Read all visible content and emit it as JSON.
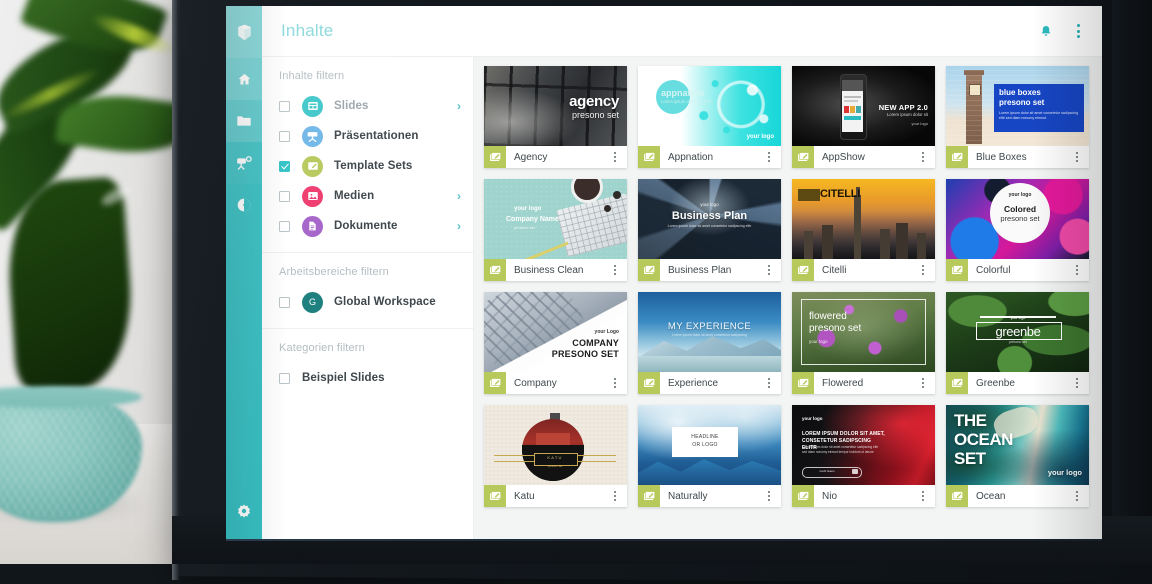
{
  "app": {
    "rail": {
      "logo_icon": "presono-logo-icon",
      "items": [
        {
          "name": "home",
          "icon": "home-icon"
        },
        {
          "name": "folder",
          "icon": "folder-icon"
        },
        {
          "name": "presentations",
          "icon": "projector-icon"
        },
        {
          "name": "analytics",
          "icon": "pie-chart-icon"
        }
      ],
      "settings_icon": "gear-icon"
    },
    "header": {
      "title": "Inhalte",
      "bell_icon": "bell-icon",
      "menu_icon": "kebab-menu-icon"
    },
    "filters": {
      "sections": [
        {
          "title": "Inhalte filtern",
          "rows": [
            {
              "label": "Slides",
              "checked": false,
              "chevron": true,
              "icon": "slides-icon",
              "color": "#3fc6c9"
            },
            {
              "label": "Präsentationen",
              "checked": false,
              "chevron": false,
              "icon": "projector-icon",
              "color": "#6fb6e8"
            },
            {
              "label": "Template Sets",
              "checked": true,
              "chevron": false,
              "icon": "template-edit-icon",
              "color": "#b6c95a"
            },
            {
              "label": "Medien",
              "checked": false,
              "chevron": true,
              "icon": "media-image-icon",
              "color": "#ef3a6e"
            },
            {
              "label": "Dokumente",
              "checked": false,
              "chevron": true,
              "icon": "document-icon",
              "color": "#a563c9"
            }
          ]
        },
        {
          "title": "Arbeitsbereiche filtern",
          "rows": [
            {
              "label": "Global Workspace",
              "checked": false,
              "chevron": false,
              "icon": "workspace-badge",
              "badge": "G",
              "color": "#1b7f7d"
            }
          ]
        },
        {
          "title": "Kategorien filtern",
          "rows": [
            {
              "label": "Beispiel Slides",
              "checked": false,
              "chevron": false,
              "icon": "none"
            }
          ]
        }
      ]
    },
    "content": {
      "card_icon": "template-edit-icon",
      "card_menu_icon": "kebab-menu-icon",
      "cards": [
        {
          "label": "Agency",
          "art": "agency",
          "title": "agency",
          "subtitle": "presono set"
        },
        {
          "label": "Appnation",
          "art": "appnation",
          "title": "appnation",
          "subtitle": "Lorem ipsum dolor sit amet",
          "logo": "your logo"
        },
        {
          "label": "AppShow",
          "art": "appshow",
          "title": "NEW APP 2.0",
          "subtitle": "Lorem ipsum dolor sit",
          "logo": "your logo"
        },
        {
          "label": "Blue Boxes",
          "art": "blueboxes",
          "title": "blue boxes",
          "subtitle": "presono set"
        },
        {
          "label": "Business Clean",
          "art": "bizclean",
          "title": "Company Name",
          "logo": "your logo"
        },
        {
          "label": "Business Plan",
          "art": "bizplan",
          "title": "Business Plan",
          "logo": "your logo"
        },
        {
          "label": "Citelli",
          "art": "citelli",
          "title": "CITELLI"
        },
        {
          "label": "Colorful",
          "art": "colorful",
          "title": "Colored",
          "subtitle": "presono set",
          "logo": "your logo"
        },
        {
          "label": "Company",
          "art": "company",
          "title": "COMPANY",
          "subtitle": "PRESONO SET",
          "logo": "your Logo"
        },
        {
          "label": "Experience",
          "art": "experience",
          "title": "MY EXPERIENCE"
        },
        {
          "label": "Flowered",
          "art": "flowered",
          "title": "flowered",
          "subtitle": "presono set",
          "logo": "your logo"
        },
        {
          "label": "Greenbe",
          "art": "greenbe",
          "title": "greenbe",
          "logo": "your logo"
        },
        {
          "label": "Katu",
          "art": "katu",
          "title": "KATU"
        },
        {
          "label": "Naturally",
          "art": "naturally",
          "title": "HEADLINE",
          "subtitle": "OR LOGO"
        },
        {
          "label": "Nio",
          "art": "nio",
          "title": "LOREM IPSUM DOLOR SIT AMET, CONSETETUR SADIPSCING ELITR",
          "logo": "your logo"
        },
        {
          "label": "Ocean",
          "art": "ocean",
          "title": "THE OCEAN SET",
          "logo": "your logo"
        }
      ]
    },
    "colors": {
      "accent_teal": "#38c1c4",
      "header_title": "#84d7da",
      "template_green": "#b6c95a",
      "content_bg": "#f3f4f4"
    }
  }
}
